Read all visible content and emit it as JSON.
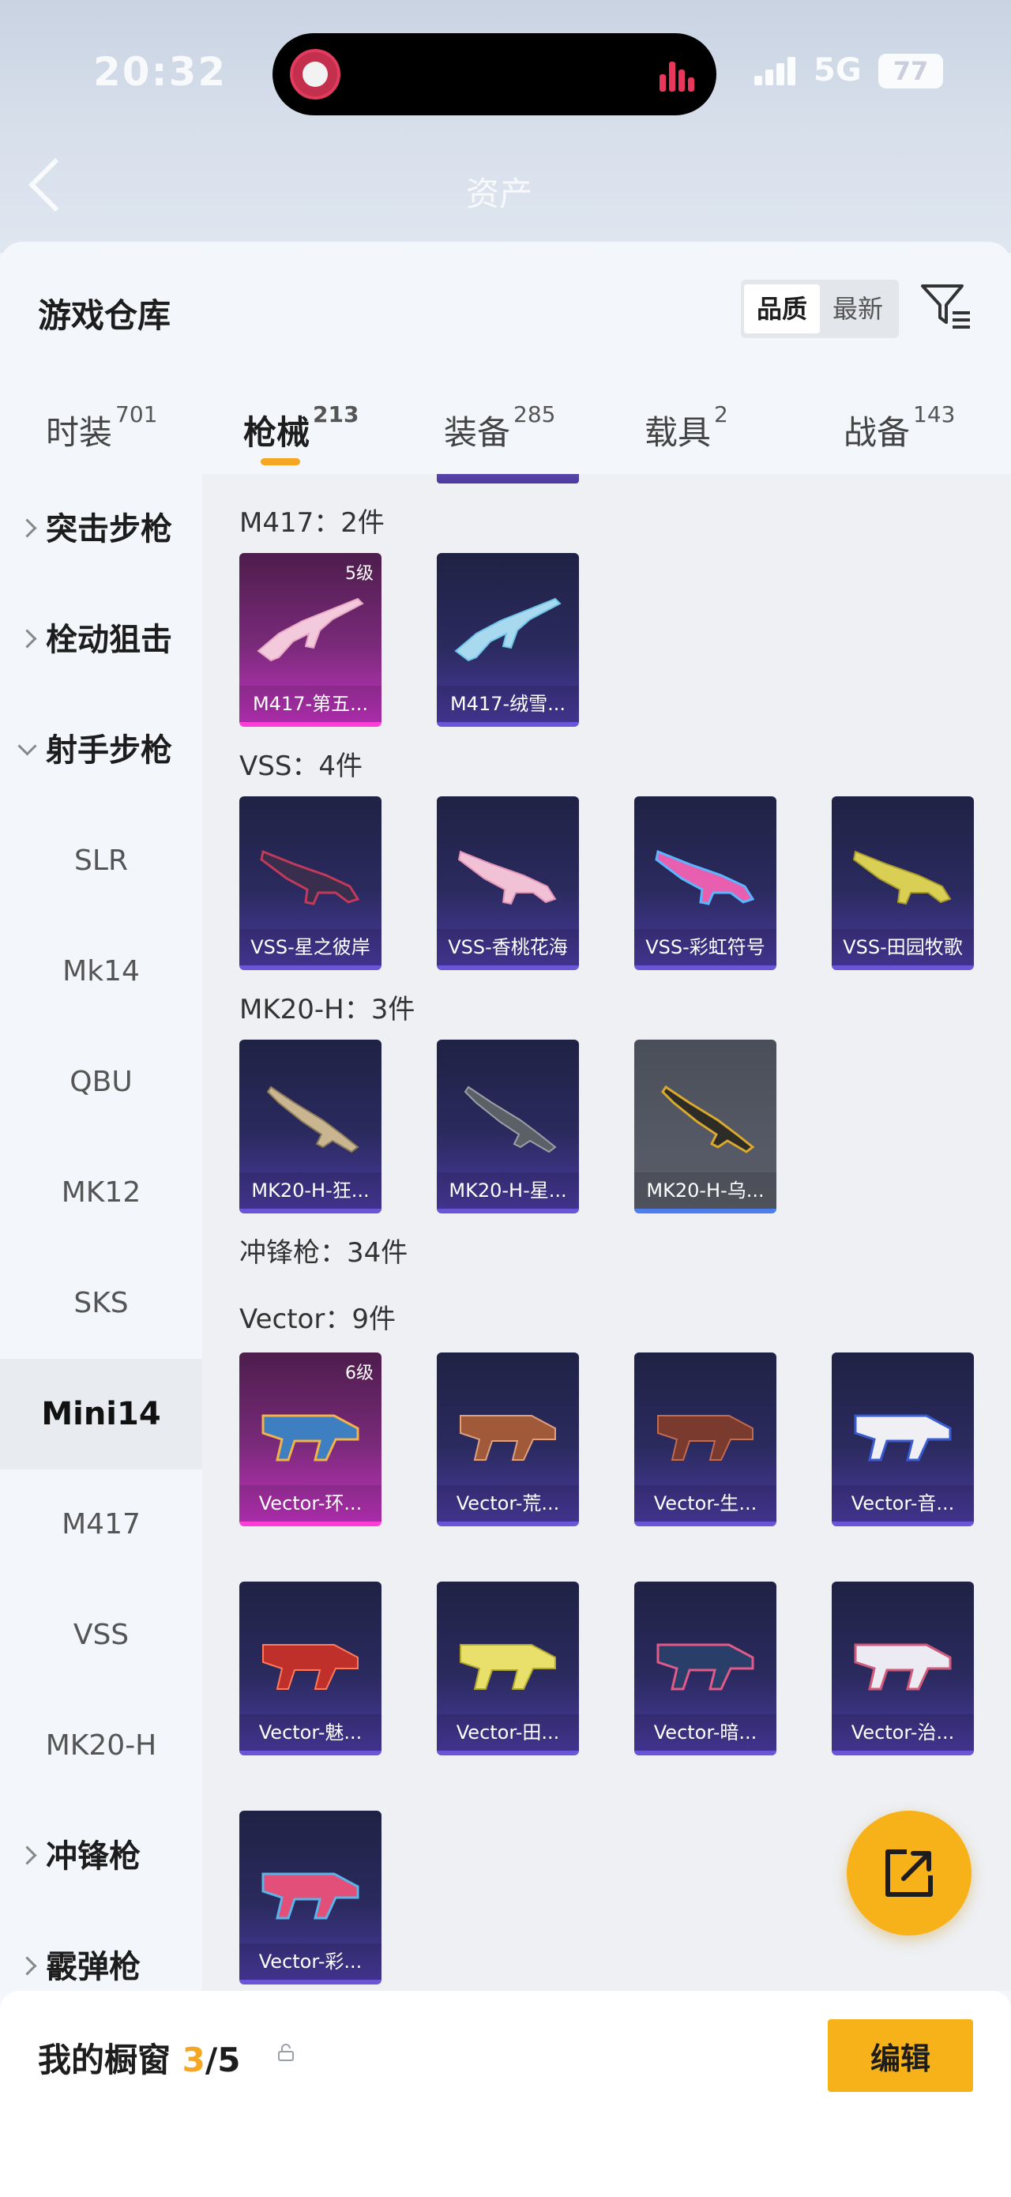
{
  "status": {
    "time": "20:32",
    "network": "5G",
    "battery": "77"
  },
  "header": {
    "title": "资产"
  },
  "sheet": {
    "title": "游戏仓库",
    "sort": {
      "quality": "品质",
      "newest": "最新"
    }
  },
  "tabs": [
    {
      "label": "时装",
      "count": "701"
    },
    {
      "label": "枪械",
      "count": "213"
    },
    {
      "label": "装备",
      "count": "285"
    },
    {
      "label": "载具",
      "count": "2"
    },
    {
      "label": "战备",
      "count": "143"
    }
  ],
  "sidebar": {
    "items": [
      "突击步枪",
      "栓动狙击",
      "射手步枪",
      "SLR",
      "Mk14",
      "QBU",
      "MK12",
      "SKS",
      "Mini14",
      "M417",
      "VSS",
      "MK20-H",
      "冲锋枪",
      "霰弹枪"
    ]
  },
  "groups": {
    "m417": "M417：2件",
    "vss": "VSS：4件",
    "mk20": "MK20-H：3件",
    "smg": "冲锋枪：34件",
    "vector": "Vector：9件"
  },
  "cards": {
    "m417": [
      {
        "name": "M417-第五...",
        "level": "5级"
      },
      {
        "name": "M417-绒雪..."
      }
    ],
    "vss": [
      {
        "name": "VSS-星之彼岸"
      },
      {
        "name": "VSS-香桃花海"
      },
      {
        "name": "VSS-彩虹符号"
      },
      {
        "name": "VSS-田园牧歌"
      }
    ],
    "mk20": [
      {
        "name": "MK20-H-狂..."
      },
      {
        "name": "MK20-H-星..."
      },
      {
        "name": "MK20-H-乌..."
      }
    ],
    "vector": [
      {
        "name": "Vector-环...",
        "level": "6级"
      },
      {
        "name": "Vector-荒..."
      },
      {
        "name": "Vector-生..."
      },
      {
        "name": "Vector-音..."
      },
      {
        "name": "Vector-魅..."
      },
      {
        "name": "Vector-田..."
      },
      {
        "name": "Vector-暗..."
      },
      {
        "name": "Vector-治..."
      },
      {
        "name": "Vector-彩..."
      }
    ]
  },
  "showcase": {
    "label": "我的橱窗",
    "current": "3",
    "total": "/5",
    "edit": "编辑"
  },
  "colors": {
    "accent": "#f5a623",
    "rare_pink": "#ff3ed8",
    "rare_purple": "#6a55d8",
    "rare_blue": "#4d7ef0"
  }
}
